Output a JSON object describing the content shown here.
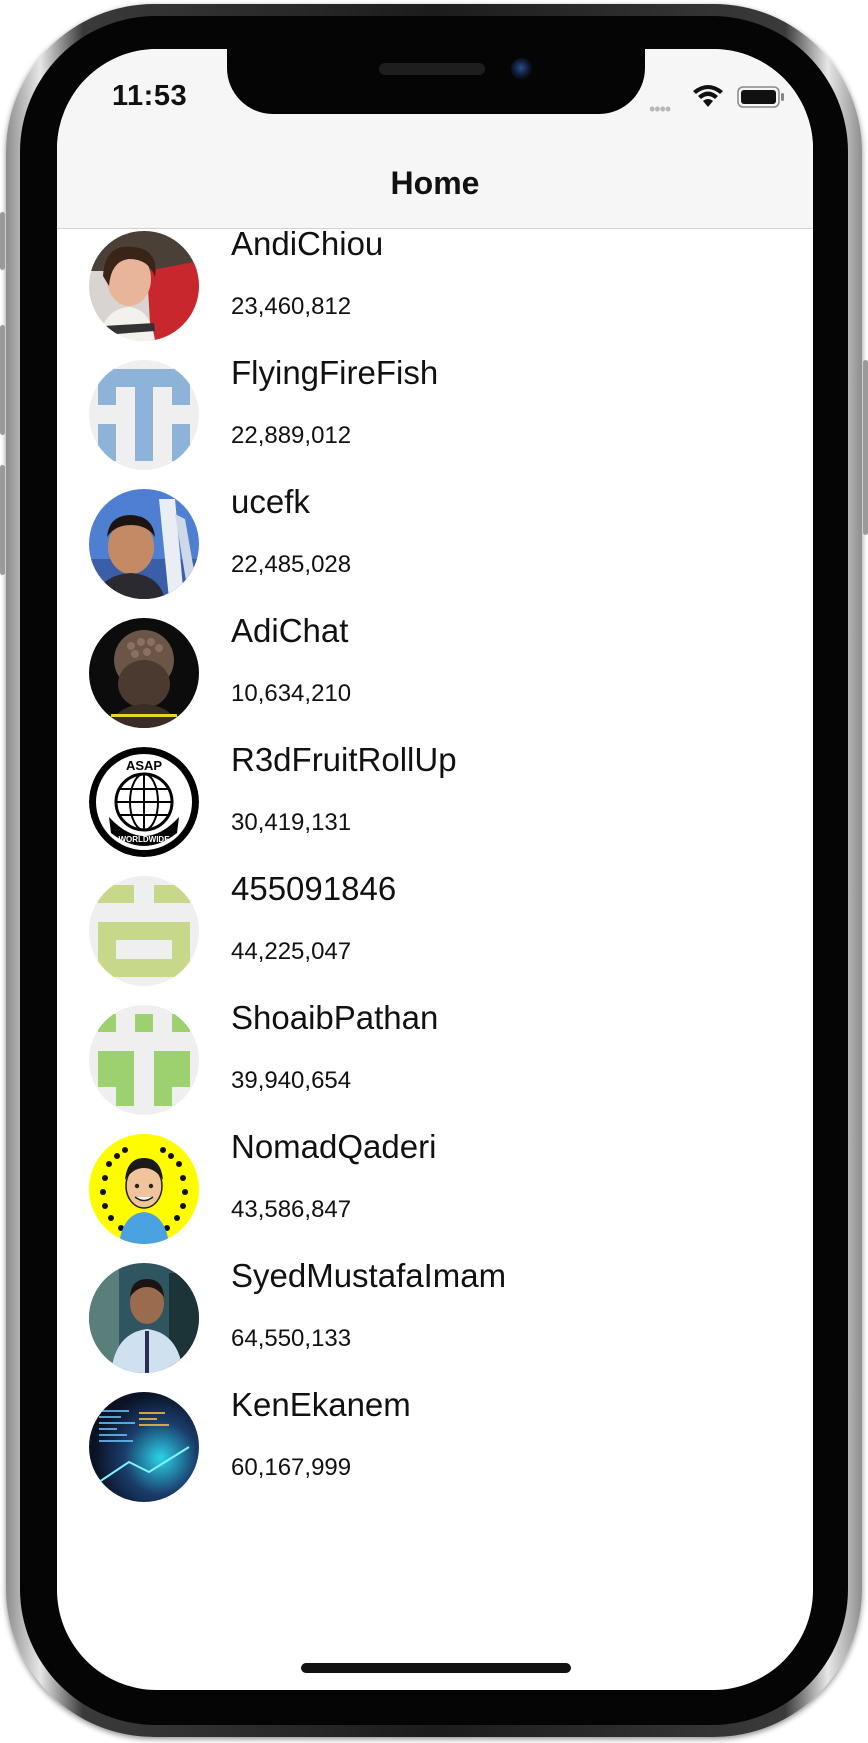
{
  "status_bar": {
    "time": "11:53",
    "signal_dots": "••••"
  },
  "nav": {
    "title": "Home"
  },
  "users": [
    {
      "name": "AndiChiou",
      "score": "23,460,812",
      "avatar_icon": "photo-avatar-woman-red-shirt"
    },
    {
      "name": "FlyingFireFish",
      "score": "22,889,012",
      "avatar_icon": "identicon-blue"
    },
    {
      "name": "ucefk",
      "score": "22,485,028",
      "avatar_icon": "photo-avatar-man-monument"
    },
    {
      "name": "AdiChat",
      "score": "10,634,210",
      "avatar_icon": "photo-avatar-buddha-statue"
    },
    {
      "name": "R3dFruitRollUp",
      "score": "30,419,131",
      "avatar_icon": "asap-worldwide-logo"
    },
    {
      "name": "455091846",
      "score": "44,225,047",
      "avatar_icon": "identicon-yellow-green"
    },
    {
      "name": "ShoaibPathan",
      "score": "39,940,654",
      "avatar_icon": "identicon-green"
    },
    {
      "name": "NomadQaderi",
      "score": "43,586,847",
      "avatar_icon": "snapcode-bitmoji-avatar"
    },
    {
      "name": "SyedMustafaImam",
      "score": "64,550,133",
      "avatar_icon": "photo-avatar-man-office"
    },
    {
      "name": "KenEkanem",
      "score": "60,167,999",
      "avatar_icon": "photo-avatar-code-screen"
    }
  ],
  "avatar_logo_text": {
    "top": "ASAP",
    "bottom": "WORLDWIDE"
  }
}
